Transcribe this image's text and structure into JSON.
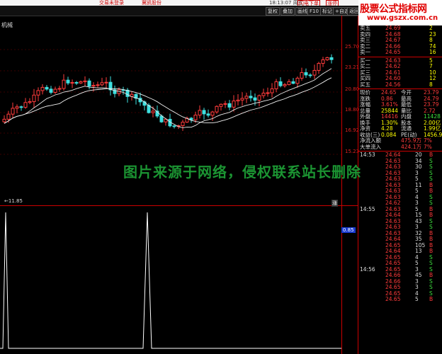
{
  "titlebar": {
    "left": "交易未登录",
    "center": "冀凯股份",
    "time": "18:13:07 周五",
    "btn1": "闪电下单",
    "btn2": "涨停"
  },
  "toolbar": {
    "items": [
      "复权",
      "叠加",
      "画线",
      "F10",
      "标记",
      "+自选",
      "返回"
    ]
  },
  "brand": {
    "line1": "股票公式指标网",
    "line2": "www.gszx.com.cn"
  },
  "stock": {
    "name": "机械"
  },
  "axis": {
    "prices": [
      "25.70",
      "23.21",
      "20.80",
      "18.80",
      "16.92",
      "15.23"
    ],
    "lowest": "←11.85",
    "lower_value": "0.85",
    "corner": "涨"
  },
  "watermark": "图片来源于网络，侵权联系站长删除",
  "orderbook": {
    "sell": [
      {
        "label": "卖五",
        "price": "24.69",
        "vol": "2"
      },
      {
        "label": "卖四",
        "price": "24.68",
        "vol": "23"
      },
      {
        "label": "卖三",
        "price": "24.67",
        "vol": "8"
      },
      {
        "label": "卖二",
        "price": "24.66",
        "vol": "74"
      },
      {
        "label": "卖一",
        "price": "24.65",
        "vol": "16"
      }
    ],
    "buy": [
      {
        "label": "买一",
        "price": "24.63",
        "vol": "5"
      },
      {
        "label": "买二",
        "price": "24.62",
        "vol": "7"
      },
      {
        "label": "买三",
        "price": "24.61",
        "vol": "10"
      },
      {
        "label": "买四",
        "price": "24.60",
        "vol": "12"
      },
      {
        "label": "买五",
        "price": "24.56",
        "vol": "8"
      }
    ]
  },
  "quote": [
    {
      "l": "现价",
      "v": "24.65",
      "l2": "今开",
      "v2": "23.79"
    },
    {
      "l": "涨跌",
      "v": "0.86",
      "l2": "最高",
      "v2": "24.79"
    },
    {
      "l": "涨幅",
      "v": "3.61%",
      "l2": "最低",
      "v2": "23.79"
    },
    {
      "l": "总量",
      "v": "25844",
      "l2": "量比",
      "v2": "2.72"
    },
    {
      "l": "外盘",
      "v": "14416",
      "l2": "内盘",
      "v2": "11428"
    },
    {
      "l": "换手",
      "v": "1.30%",
      "l2": "股本",
      "v2": "2.00亿"
    },
    {
      "l": "净资",
      "v": "4.28",
      "l2": "流通",
      "v2": "1.99亿"
    },
    {
      "l": "收益(三)",
      "v": "0.084",
      "l2": "PE(动)",
      "v2": "1456.9"
    },
    {
      "l": "净流入额",
      "v": "",
      "l2": "475.9万",
      "v2": "7%"
    },
    {
      "l": "大单流入",
      "v": "",
      "l2": "424.1万",
      "v2": "7%"
    }
  ],
  "ticks": [
    {
      "t": "14:53",
      "p": "24.64",
      "v": "20",
      "d": "B"
    },
    {
      "t": "",
      "p": "24.63",
      "v": "34",
      "d": "S"
    },
    {
      "t": "",
      "p": "24.63",
      "v": "30",
      "d": "S"
    },
    {
      "t": "",
      "p": "24.63",
      "v": "3",
      "d": "S"
    },
    {
      "t": "",
      "p": "24.63",
      "v": "5",
      "d": "S"
    },
    {
      "t": "",
      "p": "24.63",
      "v": "11",
      "d": "B"
    },
    {
      "t": "",
      "p": "24.63",
      "v": "5",
      "d": "B"
    },
    {
      "t": "",
      "p": "24.63",
      "v": "4",
      "d": "S"
    },
    {
      "t": "",
      "p": "24.62",
      "v": "3",
      "d": "S"
    },
    {
      "t": "14:55",
      "p": "24.63",
      "v": "5",
      "d": "B"
    },
    {
      "t": "",
      "p": "24.64",
      "v": "15",
      "d": "B"
    },
    {
      "t": "",
      "p": "24.63",
      "v": "43",
      "d": "S"
    },
    {
      "t": "",
      "p": "24.63",
      "v": "3",
      "d": "S"
    },
    {
      "t": "",
      "p": "24.63",
      "v": "32",
      "d": "B"
    },
    {
      "t": "",
      "p": "24.64",
      "v": "35",
      "d": "B"
    },
    {
      "t": "",
      "p": "24.65",
      "v": "105",
      "d": "B"
    },
    {
      "t": "",
      "p": "24.64",
      "v": "13",
      "d": "B"
    },
    {
      "t": "",
      "p": "24.65",
      "v": "4",
      "d": "S"
    },
    {
      "t": "",
      "p": "24.65",
      "v": "5",
      "d": "S"
    },
    {
      "t": "14:56",
      "p": "24.65",
      "v": "3",
      "d": "S"
    },
    {
      "t": "",
      "p": "24.66",
      "v": "45",
      "d": "B"
    },
    {
      "t": "",
      "p": "24.66",
      "v": "3",
      "d": "S"
    },
    {
      "t": "",
      "p": "24.65",
      "v": "3",
      "d": "S"
    },
    {
      "t": "",
      "p": "24.65",
      "v": "4",
      "d": "S"
    },
    {
      "t": "",
      "p": "24.65",
      "v": "5",
      "d": "B"
    }
  ],
  "colors": {
    "up": "#ff3b3b",
    "down": "#3ee0e0",
    "frame": "#cc0000",
    "value": "#ffff00",
    "sell": "#ffff00",
    "buy_s": "#3ee03e"
  }
}
